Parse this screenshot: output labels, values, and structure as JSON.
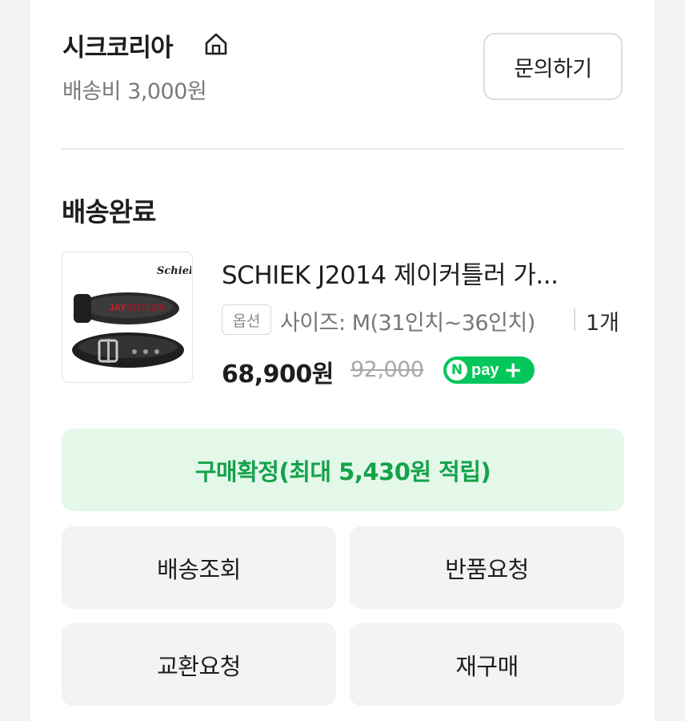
{
  "store": {
    "name": "시크코리아",
    "home_icon": "home-icon",
    "shipping_fee": "배송비 3,000원",
    "inquiry_label": "문의하기"
  },
  "order": {
    "status": "배송완료",
    "product": {
      "thumbnail": "product-belt-image",
      "brand_mark": "Schiek",
      "name": "SCHIEK J2014 제이커틀러 가...",
      "option_badge": "옵션",
      "option_text": "사이즈: M(31인치~36인치)",
      "quantity": "1개",
      "price": "68,900원",
      "original_price": "92,000",
      "npay_icon": "npay-plus-badge"
    },
    "confirm_label": "구매확정(최대 5,430원 적립)",
    "actions": [
      {
        "label": "배송조회"
      },
      {
        "label": "반품요청"
      },
      {
        "label": "교환요청"
      },
      {
        "label": "재구매"
      }
    ]
  },
  "colors": {
    "accent_green": "#03c75a",
    "confirm_bg": "#e4f8ea",
    "confirm_text": "#15a24a",
    "button_bg": "#f2f3f5"
  }
}
